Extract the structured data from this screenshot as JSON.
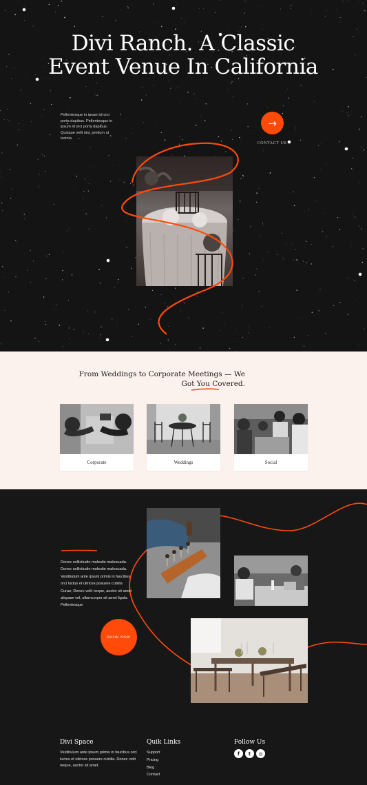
{
  "hero": {
    "title": "Divi Ranch. A Classic Event Venue In California",
    "text": "Pellentesque in ipsum id orci porta dapibus. Pellentesque in ipsum id orci porta dapibus. Quisque velit nisi, pretium ut lacinia.",
    "cta_icon": "arrow-right-icon",
    "cta_arrow": "→",
    "cta_label": "CONTACT US",
    "image": "wedding-table-photo"
  },
  "services": {
    "title": "From Weddings to Corporate Meetings — We Got You Covered.",
    "cards": [
      {
        "label": "Corporate",
        "image": "handshake-photo"
      },
      {
        "label": "Weddings",
        "image": "patio-tables-photo"
      },
      {
        "label": "Social",
        "image": "group-meeting-photo"
      }
    ]
  },
  "venue": {
    "text": "Donec sollicitudin molestie malesuada. Donec sollicitudin molestie malesuada. Vestibulum ante ipsum primis in faucibus orci luctus et ultrices posuere cubilia Curae; Donec velit neque, auctor sit amet aliquam vel, ullamcorper sit amet ligula. Pellentesque",
    "button": "BOOK NOW",
    "images": [
      "catering-photo",
      "meeting-photo",
      "dining-table-photo"
    ]
  },
  "footer": {
    "brand": "Divi Space",
    "text": "Vestibulum ante ipsum primis in faucibus orci luctus et ultrices posuere cubilia. Donec velit neque, auctor sit amet.",
    "links_title": "Quik Links",
    "links": [
      "Support",
      "Pricing",
      "Blog",
      "Contact"
    ],
    "follow_title": "Follow Us",
    "social": [
      {
        "icon": "facebook-icon",
        "glyph": "f"
      },
      {
        "icon": "twitter-icon",
        "glyph": "t"
      },
      {
        "icon": "instagram-icon",
        "glyph": "◎"
      }
    ]
  },
  "colors": {
    "accent": "#ff4a0a",
    "dark": "#171717",
    "cream": "#fbf1ed"
  }
}
